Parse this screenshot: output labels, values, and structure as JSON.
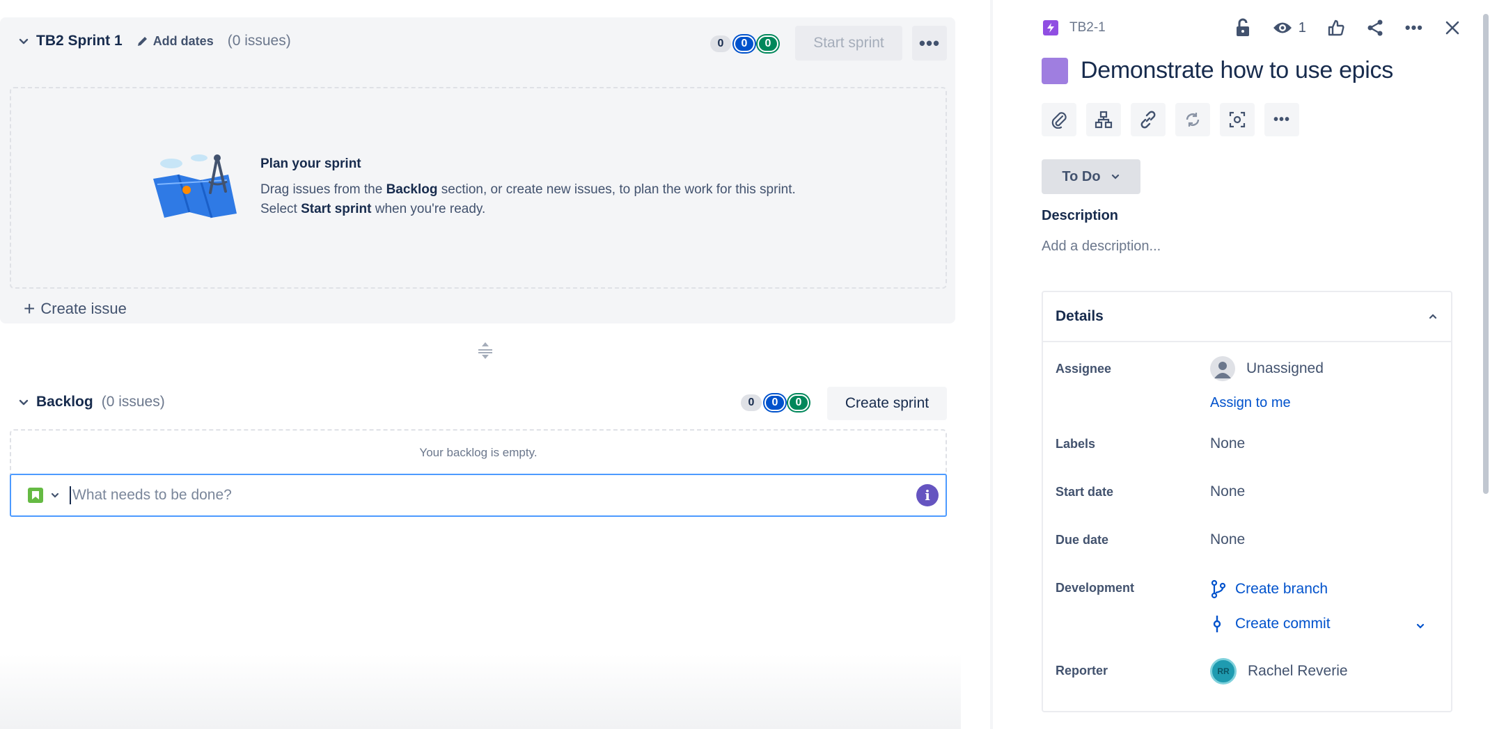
{
  "sprint": {
    "name": "TB2 Sprint 1",
    "add_dates": "Add dates",
    "issue_count": "(0 issues)",
    "counts": [
      "0",
      "0",
      "0"
    ],
    "start_button": "Start sprint",
    "more": "•••",
    "plan_title": "Plan your sprint",
    "plan_text_1": "Drag issues from the ",
    "plan_bold_1": "Backlog",
    "plan_text_2": " section, or create new issues, to plan the work for this sprint. Select ",
    "plan_bold_2": "Start sprint",
    "plan_text_3": " when you're ready.",
    "create_issue": "Create issue"
  },
  "backlog": {
    "name": "Backlog",
    "issue_count": "(0 issues)",
    "counts": [
      "0",
      "0",
      "0"
    ],
    "create_sprint": "Create sprint",
    "empty_text": "Your backlog is empty.",
    "input_placeholder": "What needs to be done?",
    "info": "i"
  },
  "issue": {
    "key": "TB2-1",
    "watch_count": "1",
    "title": "Demonstrate how to use epics",
    "status": "To Do",
    "description_label": "Description",
    "description_placeholder": "Add a description...",
    "details_title": "Details",
    "fields": {
      "assignee_label": "Assignee",
      "assignee_value": "Unassigned",
      "assign_to_me": "Assign to me",
      "labels_label": "Labels",
      "labels_value": "None",
      "start_label": "Start date",
      "start_value": "None",
      "due_label": "Due date",
      "due_value": "None",
      "dev_label": "Development",
      "create_branch": "Create branch",
      "create_commit": "Create commit",
      "reporter_label": "Reporter",
      "reporter_value": "Rachel Reverie",
      "reporter_initials": "RR"
    }
  },
  "colors": {
    "accent": "#0052cc",
    "epic": "#904ee2",
    "story": "#65ba43"
  }
}
